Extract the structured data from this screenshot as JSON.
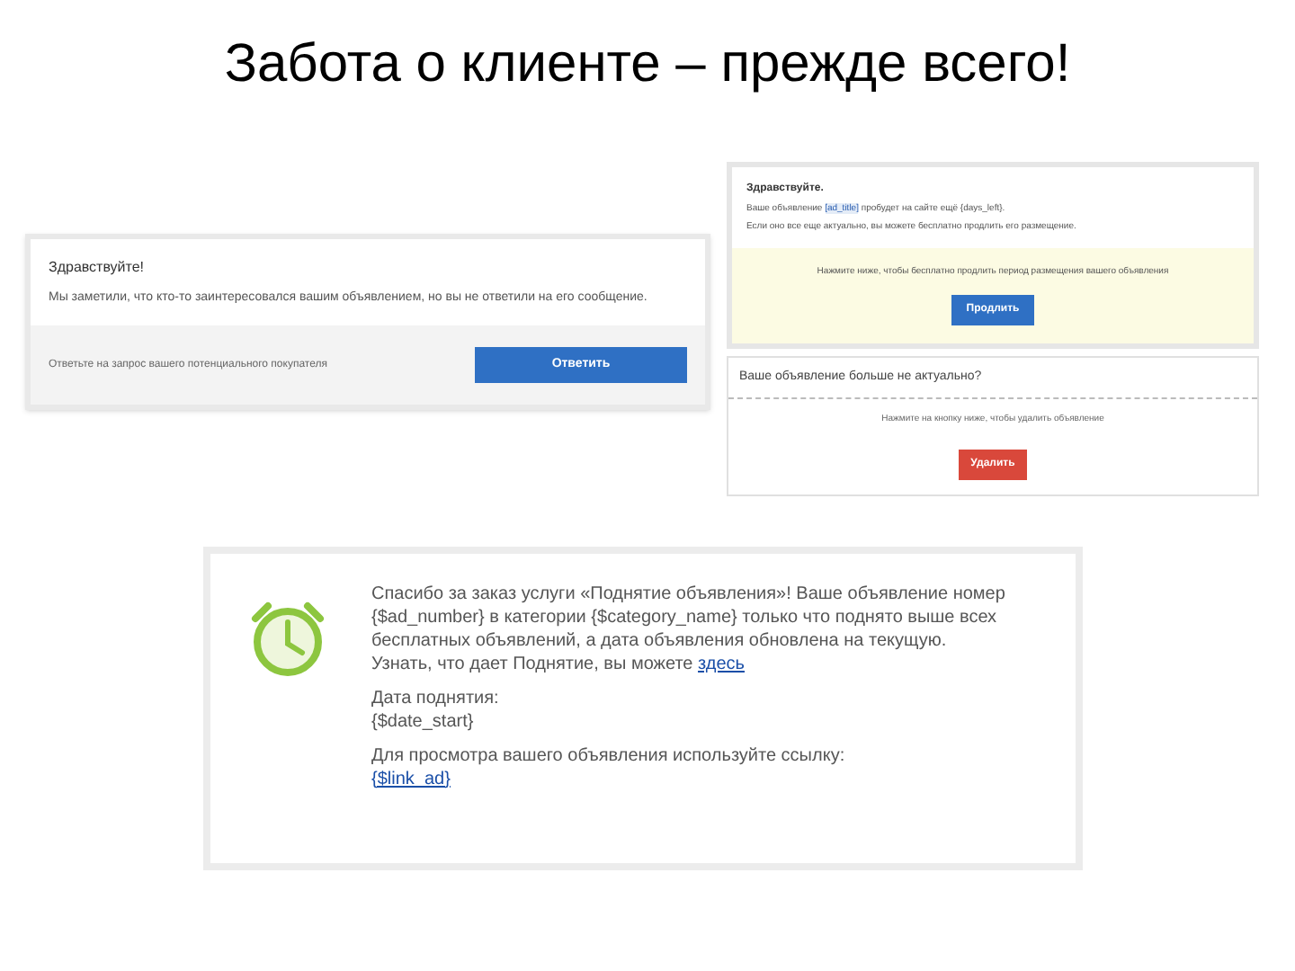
{
  "title": "Забота о клиенте – прежде всего!",
  "reply_card": {
    "greeting": "Здравствуйте!",
    "message": "Мы заметили, что кто-то заинтересовался вашим объявлением, но вы не ответили на его сообщение.",
    "prompt": "Ответьте на запрос вашего потенциального покупателя",
    "button": "Ответить"
  },
  "renew_card": {
    "greeting": "Здравствуйте.",
    "line_before": "Ваше объявление",
    "ad_link": "[ad_title]",
    "line_after": "пробудет на сайте ещё {days_left}.",
    "line_2": "Если оно все еще актуально, вы можете бесплатно продлить его размещение.",
    "hint": "Нажмите ниже, чтобы бесплатно продлить период размещения вашего объявления",
    "button": "Продлить"
  },
  "delete_card": {
    "question": "Ваше объявление больше не актуально?",
    "hint": "Нажмите на кнопку ниже, чтобы удалить объявление",
    "button": "Удалить"
  },
  "lift_card": {
    "message": "Спасибо за заказ услуги «Поднятие объявления»! Ваше объявление номер {$ad_number} в категории {$category_name} только что поднято выше всех бесплатных объявлений, а дата объявления обновлена на текущую.",
    "more_before": "Узнать, что дает Поднятие, вы можете",
    "more_link": "здесь",
    "date_label": "Дата поднятия:",
    "date_value": "{$date_start}",
    "link_label": "Для просмотра вашего объявления используйте ссылку:",
    "link_value": "{$link_ad}"
  }
}
